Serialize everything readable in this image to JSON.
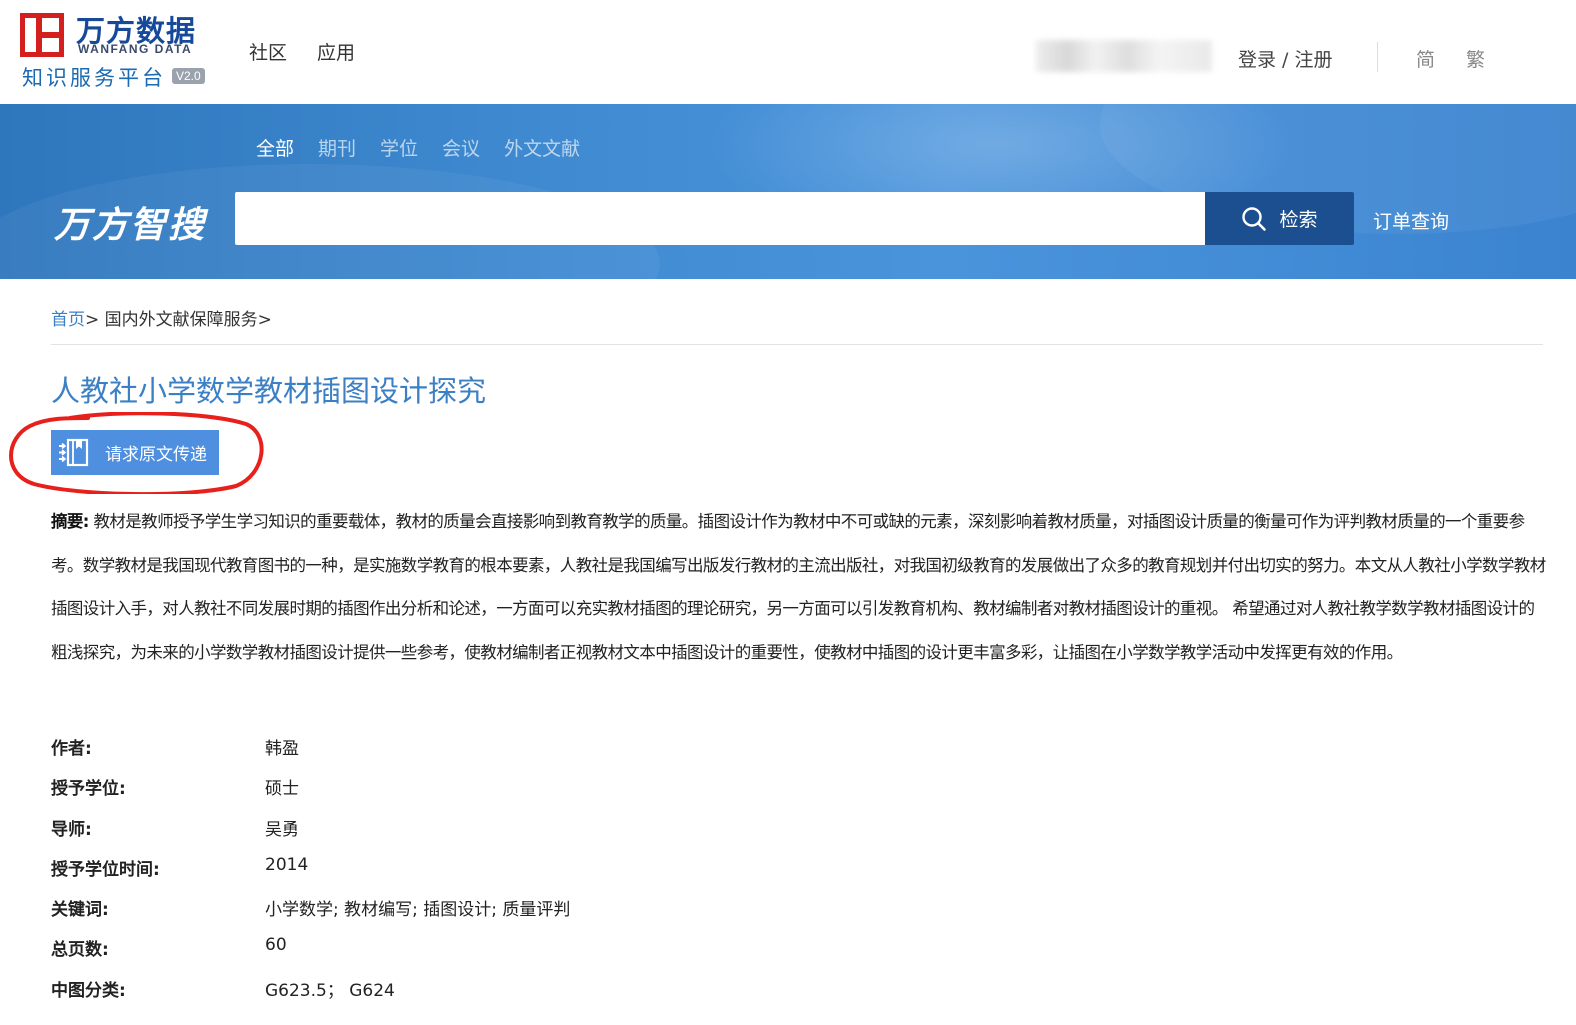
{
  "header": {
    "logo_cn": "万方数据",
    "logo_en": "WANFANG DATA",
    "logo_platform": "知识服务平台",
    "logo_version": "V2.0",
    "nav": [
      "社区",
      "应用"
    ],
    "login_label": "登录 / 注册",
    "lang_simplified": "简",
    "lang_traditional": "繁"
  },
  "search": {
    "tabs": [
      "全部",
      "期刊",
      "学位",
      "会议",
      "外文文献"
    ],
    "active_tab": 0,
    "brand": "万方智搜",
    "input_value": "",
    "button_label": "检索",
    "order_label": "订单查询"
  },
  "breadcrumb": {
    "home": "首页",
    "sep1": "> ",
    "section": "国内外文献保障服务",
    "sep2": ">"
  },
  "document": {
    "title": "人教社小学数学教材插图设计探究",
    "request_button": "请求原文传递",
    "abstract_label": "摘要:",
    "abstract_text": "教材是教师授予学生学习知识的重要载体，教材的质量会直接影响到教育教学的质量。插图设计作为教材中不可或缺的元素，深刻影响着教材质量，对插图设计质量的衡量可作为评判教材质量的一个重要参考。数学教材是我国现代教育图书的一种，是实施数学教育的根本要素，人教社是我国编写出版发行教材的主流出版社，对我国初级教育的发展做出了众多的教育规划并付出切实的努力。本文从人教社小学数学教材插图设计入手，对人教社不同发展时期的插图作出分析和论述，一方面可以充实教材插图的理论研究，另一方面可以引发教育机构、教材编制者对教材插图设计的重视。 希望通过对人教社教学数学教材插图设计的粗浅探究，为未来的小学数学教材插图设计提供一些参考，使教材编制者正视教材文本中插图设计的重要性，使教材中插图的设计更丰富多彩，让插图在小学数学教学活动中发挥更有效的作用。",
    "meta": [
      {
        "key": "作者:",
        "value": "韩盈"
      },
      {
        "key": "授予学位:",
        "value": "硕士"
      },
      {
        "key": "导师:",
        "value": "吴勇"
      },
      {
        "key": "授予学位时间:",
        "value": "2014"
      },
      {
        "key": "关键词:",
        "value": "小学数学; 教材编写; 插图设计; 质量评判"
      },
      {
        "key": "总页数:",
        "value": "60"
      },
      {
        "key": "中图分类:",
        "value": "G623.5； G624"
      }
    ]
  },
  "colors": {
    "accent_blue": "#3b7fc4",
    "banner_blue": "#3f8ad1",
    "search_button": "#1b4f8f",
    "request_button": "#4e8fe0",
    "logo_red": "#d3201e",
    "annotation_red": "#e8201c"
  }
}
